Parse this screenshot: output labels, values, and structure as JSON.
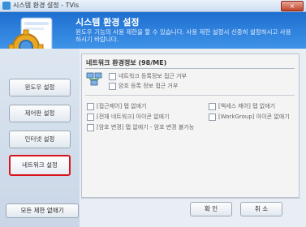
{
  "window": {
    "title": "시스템 환경 설정 - TVis",
    "close_label": "×"
  },
  "header": {
    "title": "시스템 환경 설정",
    "description": "윈도우 기능의 사용 제한을 할 수 있습니다. 사용 제한 설정시 신중히 설정하시고 사용하시기 바랍니다."
  },
  "sidebar": {
    "items": [
      {
        "label": "윈도우 설정"
      },
      {
        "label": "제어판 설정"
      },
      {
        "label": "인터넷 설정"
      },
      {
        "label": "네트워크 설정"
      }
    ],
    "reset_label": "모든 제한 없애기"
  },
  "content": {
    "section_title": "네트워크 환경정보 (98/ME)",
    "options_top": [
      "네트워크 등록정보 접근 거부",
      "암호 등록 정보 접근 거부"
    ],
    "options_left": [
      "[접근제어] 탭 없애기",
      "[전체 네트워크] 아이콘 없애기",
      "[암호 변경] 탭 없애기 - 암호 변경 불가능"
    ],
    "options_right": [
      "[액세스 제어] 탭 없애기",
      "[WorkGroup] 아이콘 없애기"
    ]
  },
  "footer": {
    "ok_label": "확 인",
    "cancel_label": "취 소"
  }
}
